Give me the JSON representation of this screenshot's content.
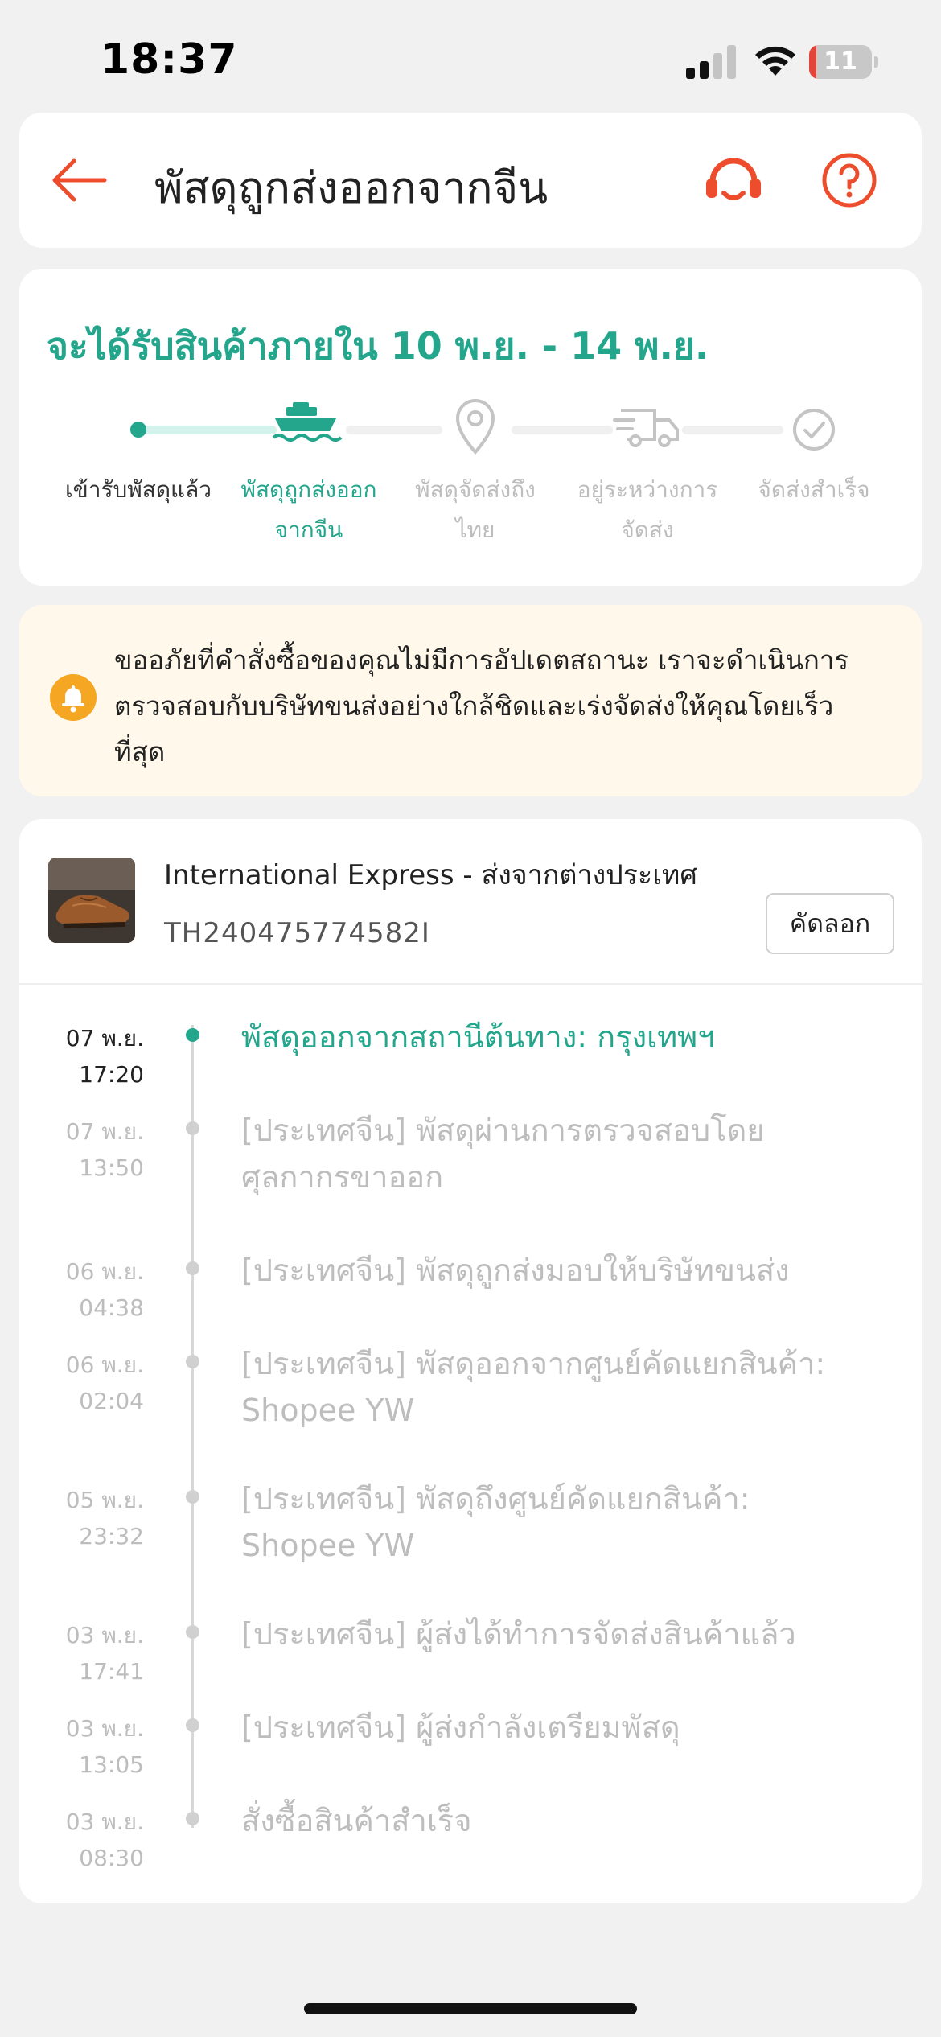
{
  "status_bar": {
    "time": "18:37",
    "battery_level": "11",
    "battery_fraction": 0.11,
    "battery_color": "#e2443a",
    "icons": [
      "signal-icon",
      "wifi-icon",
      "battery-icon"
    ]
  },
  "header": {
    "title": "พัสดุถูกส่งออกจากจีน",
    "icons": [
      "back-arrow-icon",
      "headset-icon",
      "help-icon"
    ],
    "accent_color": "#ee4d2d"
  },
  "progress": {
    "eta": "จะได้รับสินค้าภายใน 10 พ.ย. - 14 พ.ย.",
    "accent_color": "#24a68d",
    "current_step": 1,
    "steps": [
      {
        "label_line1": "เข้ารับพัสดุแล้ว",
        "label_line2": "",
        "icon": "dot-icon",
        "state": "done"
      },
      {
        "label_line1": "พัสดุถูกส่งออก",
        "label_line2": "จากจีน",
        "icon": "ship-icon",
        "state": "active"
      },
      {
        "label_line1": "พัสดุจัดส่งถึง",
        "label_line2": "ไทย",
        "icon": "location-pin-icon",
        "state": "pending"
      },
      {
        "label_line1": "อยู่ระหว่างการ",
        "label_line2": "จัดส่ง",
        "icon": "delivery-truck-icon",
        "state": "pending"
      },
      {
        "label_line1": "จัดส่งสำเร็จ",
        "label_line2": "",
        "icon": "check-circle-icon",
        "state": "pending"
      }
    ]
  },
  "notice": {
    "icon": "bell-icon",
    "line1": "ขออภัยที่คำสั่งซื้อของคุณไม่มีการอัปเดตสถานะ เราจะดำเนินการ",
    "line2": "ตรวจสอบกับบริษัทขนส่งอย่างใกล้ชิดและเร่งจัดส่งให้คุณโดยเร็ว",
    "line3": "ที่สุด"
  },
  "shipment": {
    "carrier": "International Express - ส่งจากต่างประเทศ",
    "tracking_number": "TH240475774582I",
    "copy_label": "คัดลอก",
    "thumbnail": "brown-leather-shoe-image"
  },
  "events": [
    {
      "date": "07 พ.ย.",
      "time": "17:20",
      "line1": "พัสดุออกจากสถานีต้นทาง: กรุงเทพฯ",
      "line2": "",
      "current": true
    },
    {
      "date": "07 พ.ย.",
      "time": "13:50",
      "line1": "[ประเทศจีน] พัสดุผ่านการตรวจสอบโดย",
      "line2": "ศุลกากรขาออก",
      "current": false
    },
    {
      "date": "06 พ.ย.",
      "time": "04:38",
      "line1": "[ประเทศจีน] พัสดุถูกส่งมอบให้บริษัทขนส่ง",
      "line2": "",
      "current": false
    },
    {
      "date": "06 พ.ย.",
      "time": "02:04",
      "line1": "[ประเทศจีน] พัสดุออกจากศูนย์คัดแยกสินค้า:",
      "line2": "Shopee YW",
      "current": false
    },
    {
      "date": "05 พ.ย.",
      "time": "23:32",
      "line1": "[ประเทศจีน] พัสดุถึงศูนย์คัดแยกสินค้า:",
      "line2": "Shopee YW",
      "current": false
    },
    {
      "date": "03 พ.ย.",
      "time": "17:41",
      "line1": "[ประเทศจีน] ผู้ส่งได้ทำการจัดส่งสินค้าแล้ว",
      "line2": "",
      "current": false
    },
    {
      "date": "03 พ.ย.",
      "time": "13:05",
      "line1": "[ประเทศจีน] ผู้ส่งกำลังเตรียมพัสดุ",
      "line2": "",
      "current": false
    },
    {
      "date": "03 พ.ย.",
      "time": "08:30",
      "line1": "สั่งซื้อสินค้าสำเร็จ",
      "line2": "",
      "current": false
    }
  ]
}
